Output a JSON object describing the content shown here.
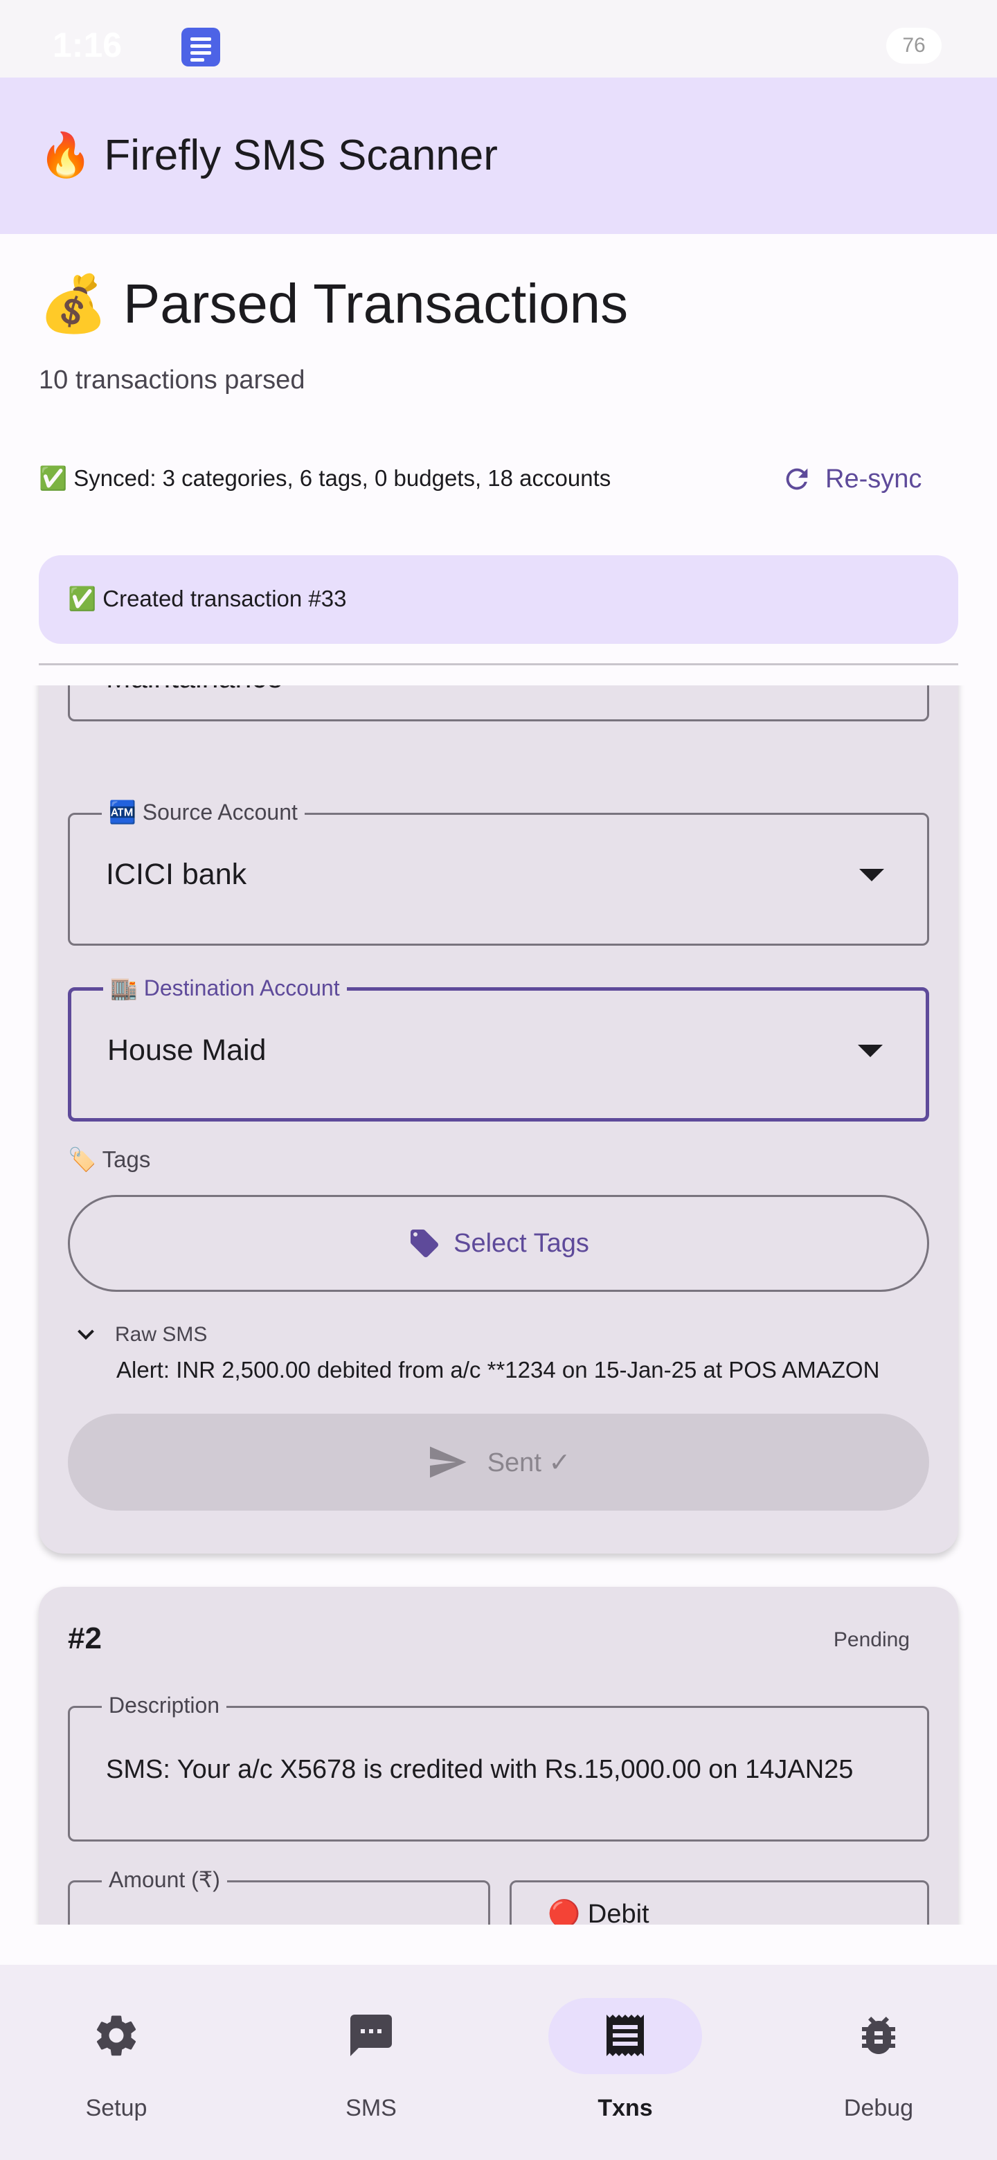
{
  "status_bar": {
    "time": "1:16",
    "battery": "76"
  },
  "app_bar": {
    "title": "🔥 Firefly SMS Scanner"
  },
  "header": {
    "title": "💰 Parsed Transactions",
    "count_text": "10 transactions parsed",
    "synced_text": "✅ Synced: 3 categories, 6 tags, 0 budgets, 18 accounts",
    "resync_label": "Re-sync"
  },
  "snackbar": {
    "text": "✅ Created transaction #33"
  },
  "card1": {
    "category_value": "Maintainance",
    "source_label": "🏧 Source Account",
    "source_value": "ICICI bank",
    "destination_label": "🏬 Destination Account",
    "destination_value": "House Maid",
    "tags_label": "🏷️ Tags",
    "select_tags_label": "Select Tags",
    "raw_sms_label": "Raw SMS",
    "raw_sms_text": "Alert: INR 2,500.00 debited from a/c **1234 on 15-Jan-25 at POS AMAZON",
    "sent_label": "Sent ✓"
  },
  "card2": {
    "number": "#2",
    "status": "Pending",
    "description_label": "Description",
    "description_value": "SMS: Your a/c X5678 is credited with Rs.15,000.00 on 14JAN25",
    "amount_label": "Amount (₹)",
    "type_value": "🔴 Debit"
  },
  "bottom_nav": [
    {
      "label": "Setup",
      "icon": "gear-icon"
    },
    {
      "label": "SMS",
      "icon": "message-icon"
    },
    {
      "label": "Txns",
      "icon": "receipt-icon",
      "active": true
    },
    {
      "label": "Debug",
      "icon": "bug-icon"
    }
  ],
  "colors": {
    "accent": "#5e4a9a",
    "app_bar": "#e8dffc",
    "card": "#e7e1ea"
  }
}
